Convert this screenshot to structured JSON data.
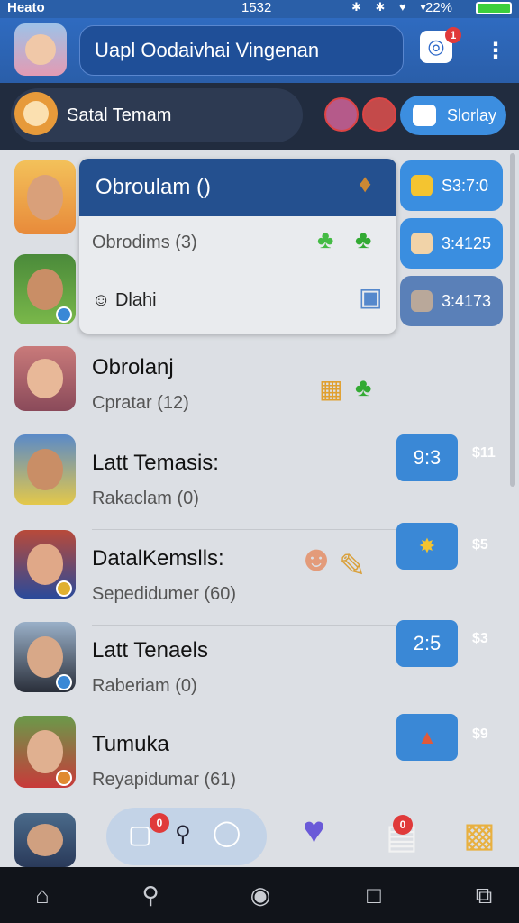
{
  "status_bar": {
    "carrier": "Heato",
    "time": "1532",
    "icons": "✱ ✱ ♥ ▾",
    "battery": "22%"
  },
  "header": {
    "title": "Uapl Oodaivhai Vingenan",
    "badge_count": "1",
    "chat_icon": "chat-icon",
    "more_icon": "more-vertical-icon"
  },
  "sub_header": {
    "section_label": "Satal Temam",
    "follow_label": "Slorlay"
  },
  "popup": {
    "title": "Obroulam ()",
    "line1": "Obrodims (3)",
    "line2": "Dlahi",
    "chips": [
      "S3:7:0",
      "3:4125",
      "3:4173"
    ]
  },
  "rows": [
    {
      "name": "Obrolanj",
      "preview": "Cpratar (12)",
      "time": "",
      "side_time": ""
    },
    {
      "name": "Latt Temasis:",
      "preview": "Rakaclam (0)",
      "time": "9:3",
      "side_time": "$11"
    },
    {
      "name": "DatalKemslls:",
      "preview": "Sepedidumer (60)",
      "time": "",
      "side_time": "$5"
    },
    {
      "name": "Latt Tenaels",
      "preview": "Raberiam (0)",
      "time": "2:5",
      "side_time": "$3"
    },
    {
      "name": "Tumuka",
      "preview": "Reyapidumar (61)",
      "time": "",
      "side_time": "$9"
    }
  ],
  "bottom": {
    "badge_count": "0",
    "badge_count2": "0"
  },
  "colors": {
    "header_blue": "#2f6bc0",
    "sub_header_dark": "#212c3f",
    "chip_blue": "#3a88d6",
    "badge_red": "#e03a3a"
  }
}
